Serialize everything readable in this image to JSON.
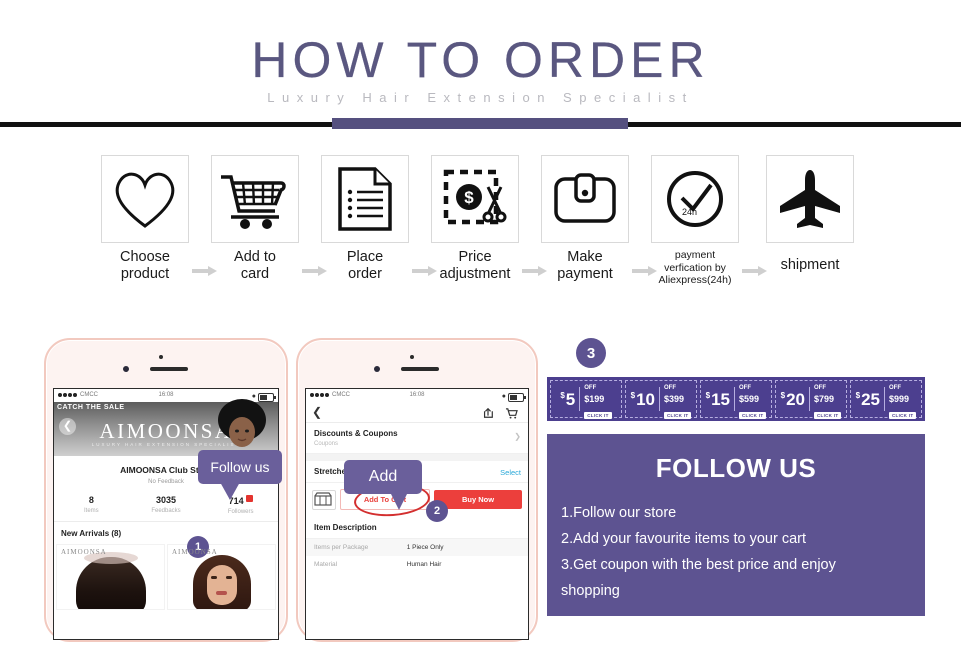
{
  "header": {
    "title": "HOW TO ORDER",
    "subtitle": "Luxury Hair Extension Specialist"
  },
  "steps": [
    {
      "icon": "heart-icon",
      "line1": "Choose",
      "line2": "product"
    },
    {
      "icon": "shopping-cart-icon",
      "line1": "Add to",
      "line2": "card"
    },
    {
      "icon": "document-icon",
      "line1": "Place",
      "line2": "order"
    },
    {
      "icon": "price-cut-icon",
      "line1": "Price",
      "line2": "adjustment"
    },
    {
      "icon": "wallet-icon",
      "line1": "Make",
      "line2": "payment"
    },
    {
      "icon": "clock-check-icon",
      "line1": "payment",
      "line2": "verfication by",
      "line3": "Aliexpress(24h)",
      "badge": "24h"
    },
    {
      "icon": "airplane-icon",
      "line1": "shipment",
      "line2": ""
    }
  ],
  "phone1": {
    "status": {
      "carrier": "CMCC",
      "time": "16:08"
    },
    "sale_tag": "CATCH THE SALE",
    "brand": "AIMOONSA",
    "brand_sub": "LUXURY HAIR EXTENSION SPECIALIST",
    "store_name": "AIMOONSA Club Store",
    "feedback": "No Feedback",
    "stats": [
      {
        "num": "8",
        "label": "Items"
      },
      {
        "num": "3035",
        "label": "Feedbacks"
      },
      {
        "num": "714",
        "label": "Followers"
      }
    ],
    "arrivals": "New Arrivals (8)",
    "watermark": "AIMOONSA",
    "bubble": "Follow us",
    "badge": "1"
  },
  "phone2": {
    "status": {
      "carrier": "CMCC",
      "time": "16:08"
    },
    "coupons_title": "Discounts & Coupons",
    "coupons_sub": "Coupons",
    "length_title": "Stretched Length",
    "select_label": "Select",
    "add_to_cart": "Add To Cart",
    "buy_now": "Buy Now",
    "desc_title": "Item Description",
    "desc_rows": [
      {
        "key": "Items per Package",
        "value": "1 Piece Only"
      },
      {
        "key": "Material",
        "value": "Human Hair"
      }
    ],
    "bubble": "Add",
    "badge": "2"
  },
  "right": {
    "badge": "3",
    "coupons": [
      {
        "value": "5",
        "currency": "$",
        "off": "OFF",
        "min": "$199",
        "cta": "CLICK IT"
      },
      {
        "value": "10",
        "currency": "$",
        "off": "OFF",
        "min": "$399",
        "cta": "CLICK IT"
      },
      {
        "value": "15",
        "currency": "$",
        "off": "OFF",
        "min": "$599",
        "cta": "CLICK IT"
      },
      {
        "value": "20",
        "currency": "$",
        "off": "OFF",
        "min": "$799",
        "cta": "CLICK IT"
      },
      {
        "value": "25",
        "currency": "$",
        "off": "OFF",
        "min": "$999",
        "cta": "CLICK IT"
      }
    ],
    "follow_title": "FOLLOW US",
    "follow_lines": [
      "1.Follow our store",
      "2.Add your favourite items to your cart",
      "3.Get coupon with the best price and enjoy",
      "shopping"
    ]
  },
  "colors": {
    "accent_purple": "#5d5391",
    "coupon_bg": "#4c3f8f",
    "title_purple": "#5a5780",
    "red": "#ec3f3c",
    "link_blue": "#2aa8d8"
  }
}
